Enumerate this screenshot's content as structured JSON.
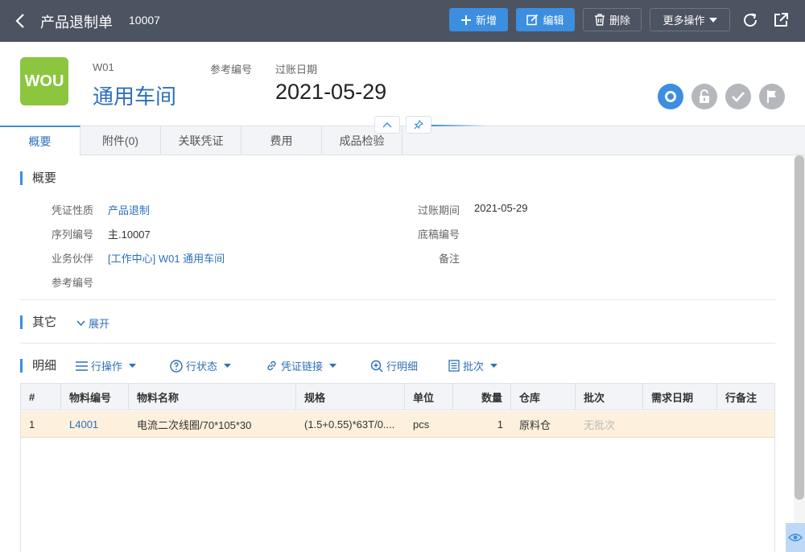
{
  "topbar": {
    "title": "产品退制单",
    "doc_no": "10007",
    "buttons": {
      "add": "新增",
      "edit": "编辑",
      "delete": "删除",
      "more": "更多操作"
    }
  },
  "header": {
    "logo_text": "WOU",
    "code": "W01",
    "name": "通用车间",
    "ref_label": "参考编号",
    "date_label": "过账日期",
    "date": "2021-05-29"
  },
  "tabs": [
    {
      "label": "概要"
    },
    {
      "label": "附件(0)"
    },
    {
      "label": "关联凭证"
    },
    {
      "label": "费用"
    },
    {
      "label": "成品检验"
    }
  ],
  "summary": {
    "title": "概要",
    "fields": {
      "type_label": "凭证性质",
      "type_value": "产品退制",
      "serial_label": "序列编号",
      "serial_value": "主.10007",
      "partner_label": "业务伙伴",
      "partner_value": "[工作中心] W01 通用车间",
      "ref_label": "参考编号",
      "period_label": "过账期间",
      "period_value": "2021-05-29",
      "draft_label": "底稿编号",
      "remark_label": "备注"
    }
  },
  "other": {
    "title": "其它",
    "expand": "展开"
  },
  "detail": {
    "title": "明细",
    "tools": {
      "row_ops": "行操作",
      "row_status": "行状态",
      "doc_link": "凭证链接",
      "row_detail": "行明细",
      "batch": "批次"
    },
    "columns": [
      "#",
      "物料编号",
      "物料名称",
      "规格",
      "单位",
      "数量",
      "仓库",
      "批次",
      "需求日期",
      "行备注"
    ],
    "rows": [
      {
        "no": "1",
        "code": "L4001",
        "name": "电流二次线圈/70*105*30",
        "spec": "(1.5+0.55)*63T/0....",
        "unit": "pcs",
        "qty": "1",
        "warehouse": "原料仓",
        "batch": "无批次",
        "need_date": "",
        "remark": ""
      }
    ]
  },
  "colors": {
    "topbar": "#4c5361",
    "primary": "#3c8ee0",
    "link": "#2e6fbb",
    "logo": "#8cc63f",
    "row_highlight": "#fdf0dc"
  }
}
